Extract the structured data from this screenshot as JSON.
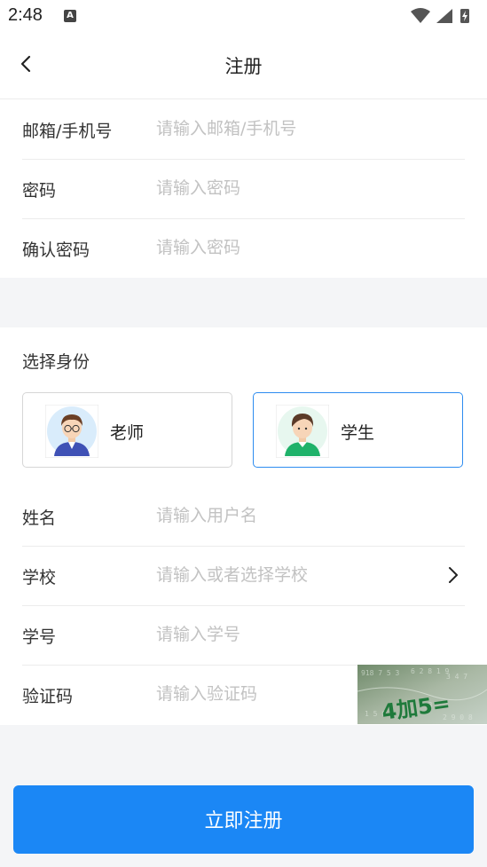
{
  "status_bar": {
    "time": "2:48",
    "notification_icon": "A"
  },
  "header": {
    "title": "注册",
    "back_icon": "chevron-left-icon"
  },
  "account": {
    "email": {
      "label": "邮箱/手机号",
      "placeholder": "请输入邮箱/手机号"
    },
    "password": {
      "label": "密码",
      "placeholder": "请输入密码"
    },
    "confirm_password": {
      "label": "确认密码",
      "placeholder": "请输入密码"
    }
  },
  "identity": {
    "title": "选择身份",
    "options": [
      {
        "label": "老师",
        "selected": false
      },
      {
        "label": "学生",
        "selected": true
      }
    ]
  },
  "profile": {
    "name": {
      "label": "姓名",
      "placeholder": "请输入用户名"
    },
    "school": {
      "label": "学校",
      "placeholder": "请输入或者选择学校"
    },
    "student_id": {
      "label": "学号",
      "placeholder": "请输入学号"
    },
    "captcha": {
      "label": "验证码",
      "placeholder": "请输入验证码",
      "image_text": "4加5="
    }
  },
  "submit_label": "立即注册",
  "colors": {
    "accent": "#1b87f5",
    "selected_border": "#2d8cf0",
    "background": "#f4f5f7"
  }
}
